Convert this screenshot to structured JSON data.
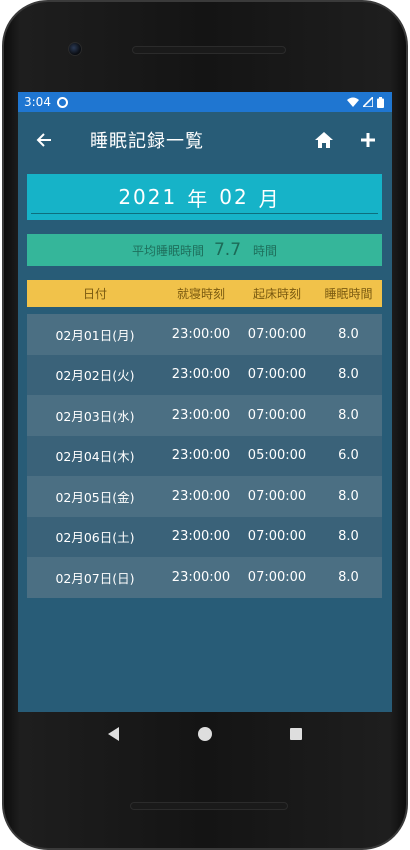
{
  "status": {
    "time": "3:04"
  },
  "appbar": {
    "title": "睡眠記録一覧",
    "icons": {
      "back": "arrow-back-icon",
      "home": "home-icon",
      "add": "plus-icon"
    }
  },
  "month": {
    "year": "2021",
    "year_unit": "年",
    "month": "02",
    "month_unit": "月"
  },
  "average": {
    "label": "平均睡眠時間",
    "value": "7.7",
    "unit": "時間"
  },
  "table": {
    "headers": {
      "date": "日付",
      "bedtime": "就寝時刻",
      "waketime": "起床時刻",
      "sleep": "睡眠時間"
    },
    "rows": [
      {
        "date": "02月01日(月)",
        "bedtime": "23:00:00",
        "waketime": "07:00:00",
        "sleep": "8.0"
      },
      {
        "date": "02月02日(火)",
        "bedtime": "23:00:00",
        "waketime": "07:00:00",
        "sleep": "8.0"
      },
      {
        "date": "02月03日(水)",
        "bedtime": "23:00:00",
        "waketime": "07:00:00",
        "sleep": "8.0"
      },
      {
        "date": "02月04日(木)",
        "bedtime": "23:00:00",
        "waketime": "05:00:00",
        "sleep": "6.0"
      },
      {
        "date": "02月05日(金)",
        "bedtime": "23:00:00",
        "waketime": "07:00:00",
        "sleep": "8.0"
      },
      {
        "date": "02月06日(土)",
        "bedtime": "23:00:00",
        "waketime": "07:00:00",
        "sleep": "8.0"
      },
      {
        "date": "02月07日(日)",
        "bedtime": "23:00:00",
        "waketime": "07:00:00",
        "sleep": "8.0"
      }
    ]
  },
  "colors": {
    "statusbar": "#1f76d1",
    "background": "#285c77",
    "month_box": "#16b3c8",
    "average_box": "#35b69a",
    "table_header": "#f1c24a"
  },
  "navbar": {
    "back": "nav-back-icon",
    "home": "nav-home-icon",
    "recents": "nav-recents-icon"
  }
}
